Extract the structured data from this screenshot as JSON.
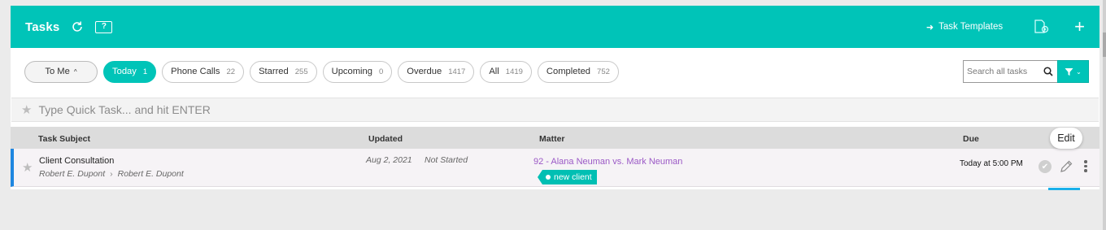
{
  "header": {
    "title": "Tasks",
    "help_label": "?",
    "templates_label": "Task Templates",
    "brand_color": "#00c4b8"
  },
  "filters": {
    "to_me_label": "To Me",
    "items": [
      {
        "label": "Today",
        "count": "1",
        "active": true
      },
      {
        "label": "Phone Calls",
        "count": "22"
      },
      {
        "label": "Starred",
        "count": "255"
      },
      {
        "label": "Upcoming",
        "count": "0"
      },
      {
        "label": "Overdue",
        "count": "1417"
      },
      {
        "label": "All",
        "count": "1419"
      },
      {
        "label": "Completed",
        "count": "752"
      }
    ]
  },
  "search": {
    "placeholder": "Search all tasks"
  },
  "quick_task": {
    "placeholder": "Type Quick Task... and hit ENTER"
  },
  "table": {
    "columns": {
      "subject": "Task Subject",
      "updated": "Updated",
      "matter": "Matter",
      "due": "Due"
    },
    "rows": [
      {
        "subject": "Client Consultation",
        "assigned_by": "Robert E. Dupont",
        "assigned_to": "Robert E. Dupont",
        "updated": "Aug 2, 2021",
        "status": "Not Started",
        "matter": "92 - Alana Neuman vs. Mark Neuman",
        "tag": "new client",
        "due": "Today at 5:00 PM"
      }
    ]
  },
  "tooltip": {
    "label": "Edit"
  },
  "icons": {
    "refresh": "refresh-icon",
    "help": "help-icon",
    "arrow": "arrow-right-icon",
    "templates": "task-templates-icon",
    "add": "plus-icon",
    "search": "search-icon",
    "filter": "filter-icon",
    "star": "star-icon",
    "complete": "check-circle-icon",
    "edit": "pencil-icon",
    "more": "more-vertical-icon"
  }
}
